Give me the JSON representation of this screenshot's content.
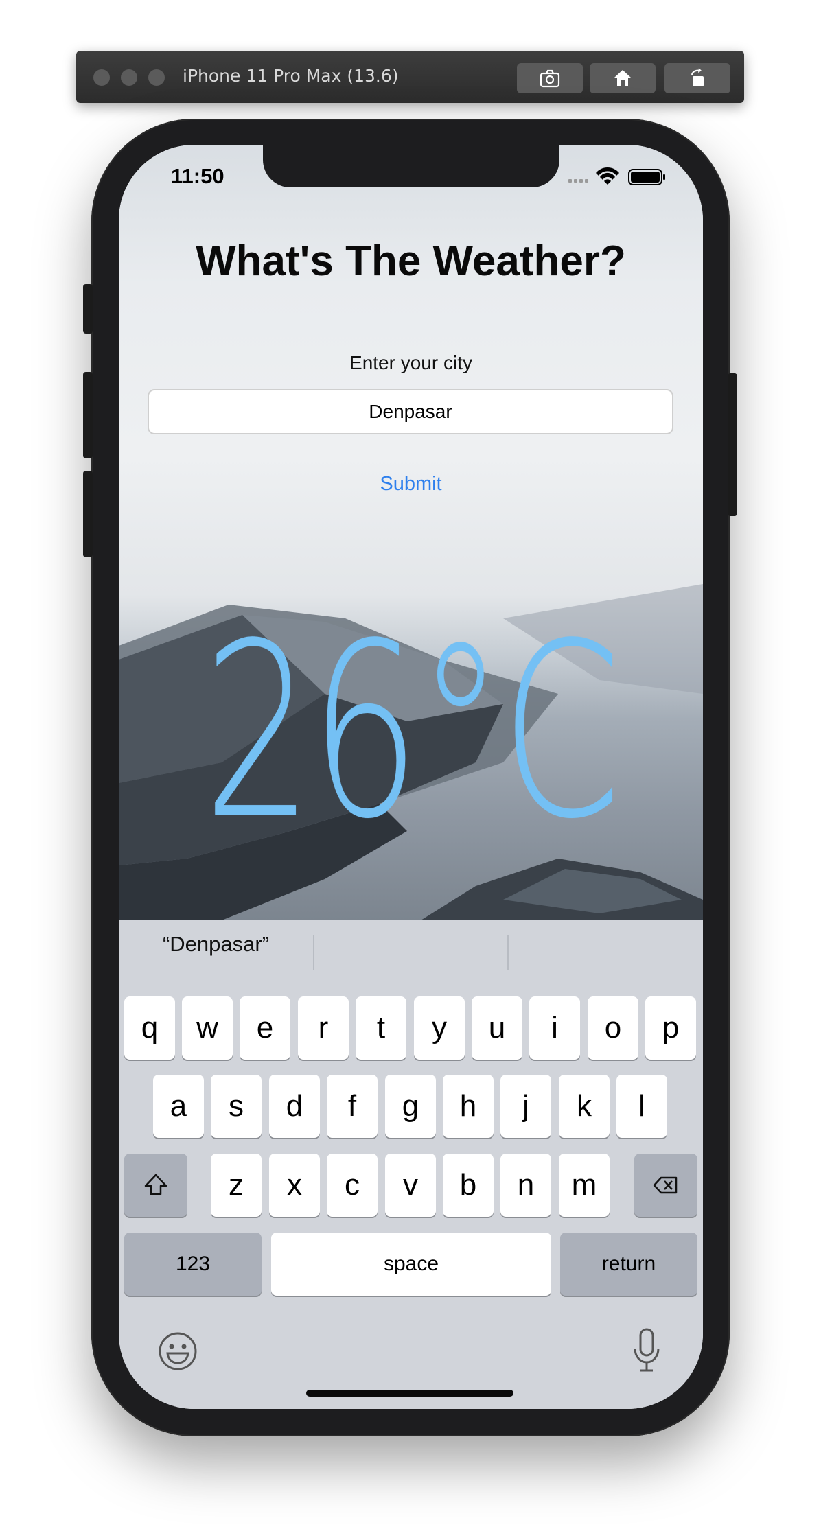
{
  "simulator": {
    "title": "iPhone 11 Pro Max (13.6)",
    "buttons": [
      "screenshot-icon",
      "home-icon",
      "rotate-icon"
    ]
  },
  "status_bar": {
    "time": "11:50"
  },
  "app": {
    "title": "What's The Weather?",
    "city_label": "Enter your city",
    "city_value": "Denpasar",
    "submit_label": "Submit",
    "temperature": "26°C",
    "colors": {
      "temperature": "#74c0f4",
      "submit": "#2f80ed"
    }
  },
  "keyboard": {
    "suggestions": [
      "“Denpasar”",
      "",
      ""
    ],
    "row1": [
      "q",
      "w",
      "e",
      "r",
      "t",
      "y",
      "u",
      "i",
      "o",
      "p"
    ],
    "row2": [
      "a",
      "s",
      "d",
      "f",
      "g",
      "h",
      "j",
      "k",
      "l"
    ],
    "row3": [
      "z",
      "x",
      "c",
      "v",
      "b",
      "n",
      "m"
    ],
    "numbers_label": "123",
    "space_label": "space",
    "return_label": "return"
  }
}
